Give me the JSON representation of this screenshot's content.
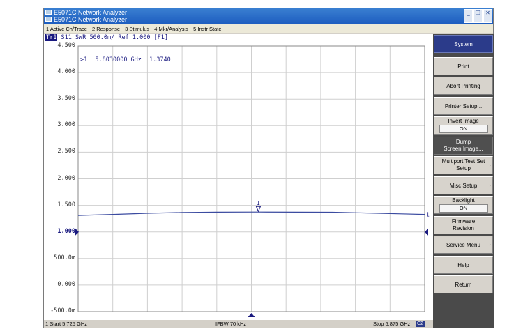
{
  "window": {
    "title_lines": [
      "E5071C Network Analyzer",
      "E5071C Network Analyzer"
    ],
    "minimize_glyph": "_",
    "restore_glyph": "❐",
    "close_glyph": "✕"
  },
  "menu": [
    "1 Active Ch/Trace",
    "2 Response",
    "3 Stimulus",
    "4 Mkr/Analysis",
    "5 Instr State"
  ],
  "trace": {
    "id": "Tr1",
    "parameter": "S11",
    "format_scale": "SWR 500.0m/ Ref 1.000 [F1]",
    "color": "#1a1a80"
  },
  "y_axis_labels": [
    "4.500",
    "4.000",
    "3.500",
    "3.000",
    "2.500",
    "2.000",
    "1.500",
    "1.000",
    "500.0m",
    "0.000",
    "-500.0m"
  ],
  "marker": {
    "label": ">1",
    "frequency": "5.8030000 GHz",
    "value": "1.3740",
    "tag": "1",
    "end_tag": "1"
  },
  "chart_data": {
    "type": "line",
    "x_unit": "GHz",
    "xlim": [
      5.725,
      5.875
    ],
    "ylim": [
      -0.5,
      4.5
    ],
    "y_per_div": 0.5,
    "ref_value": 1.0,
    "grid": true,
    "series": [
      {
        "x": [
          5.725,
          5.74,
          5.755,
          5.77,
          5.785,
          5.803,
          5.82,
          5.835,
          5.85,
          5.865,
          5.875
        ],
        "values": [
          1.31,
          1.33,
          1.35,
          1.365,
          1.372,
          1.374,
          1.372,
          1.37,
          1.355,
          1.34,
          1.33
        ]
      }
    ]
  },
  "status": {
    "start": "1 Start 5.725 GHz",
    "ifbw": "IFBW 70 kHz",
    "stop": "Stop 5.875 GHz",
    "badge": "C2"
  },
  "softkeys": {
    "title": "System",
    "print": "Print",
    "abort": "Abort Printing",
    "printer_setup": "Printer Setup...",
    "invert_image": "Invert Image",
    "invert_value": "ON",
    "dump_1": "Dump",
    "dump_2": "Screen Image...",
    "multiport_1": "Multiport Test Set",
    "multiport_2": "Setup",
    "misc": "Misc Setup",
    "backlight": "Backlight",
    "backlight_value": "ON",
    "firmware_1": "Firmware",
    "firmware_2": "Revision",
    "service": "Service Menu",
    "help": "Help",
    "return": "Return"
  }
}
